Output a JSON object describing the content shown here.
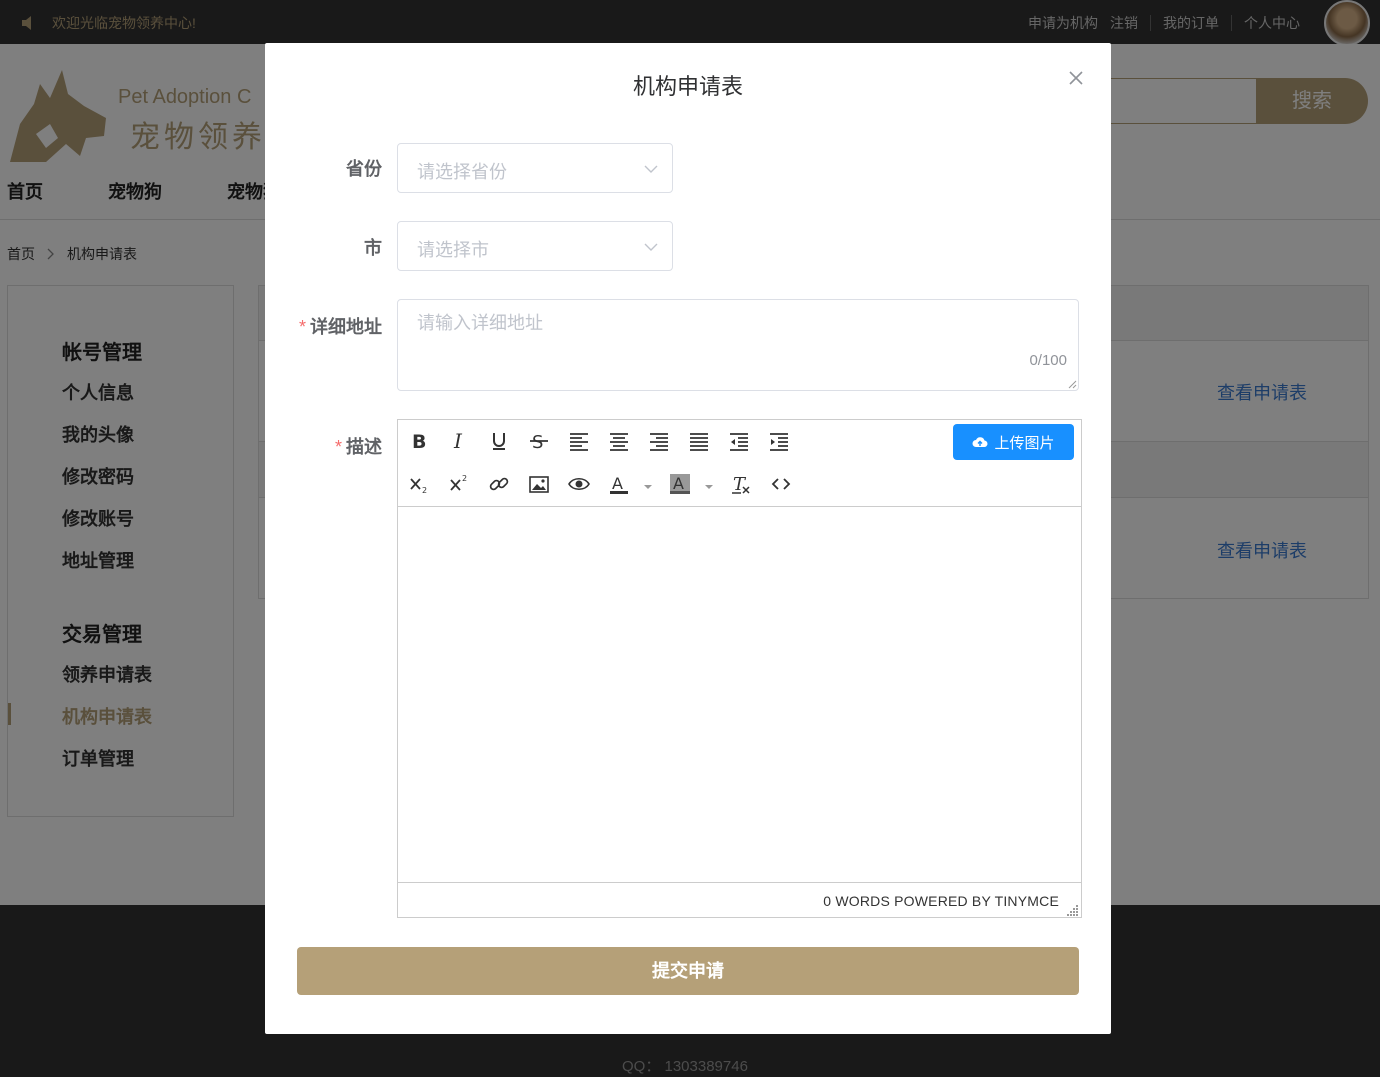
{
  "topbar": {
    "welcome": "欢迎光临宠物领养中心!",
    "links": [
      "申请为机构",
      "注销",
      "我的订单",
      "个人中心"
    ]
  },
  "header": {
    "logo_en": "Pet Adoption C",
    "logo_cn": "宠物领养中",
    "search_button": "搜索",
    "nav": [
      "首页",
      "宠物狗",
      "宠物猫"
    ]
  },
  "breadcrumb": [
    "首页",
    "机构申请表"
  ],
  "sidebar": {
    "group1": "帐号管理",
    "group1_items": [
      "个人信息",
      "我的头像",
      "修改密码",
      "修改账号",
      "地址管理"
    ],
    "group2": "交易管理",
    "group2_items": [
      "领养申请表",
      "机构申请表",
      "订单管理"
    ],
    "active_item": "机构申请表"
  },
  "content": {
    "view_links": [
      "查看申请表",
      "查看申请表"
    ]
  },
  "footer": {
    "qq": "QQ： 1303389746"
  },
  "modal": {
    "title": "机构申请表",
    "province": {
      "label": "省份",
      "placeholder": "请选择省份"
    },
    "city": {
      "label": "市",
      "placeholder": "请选择市"
    },
    "address": {
      "label": "详细地址",
      "placeholder": "请输入详细地址",
      "count": "0/100",
      "required": true
    },
    "description": {
      "label": "描述",
      "required": true
    },
    "editor": {
      "upload_button": "上传图片",
      "status": "0 WORDS POWERED BY TINYMCE"
    },
    "submit": "提交申请"
  },
  "colors": {
    "brand": "#b5a078",
    "primary_blue": "#1890ff",
    "required": "#f56c6c",
    "link": "#3b7bd0"
  }
}
